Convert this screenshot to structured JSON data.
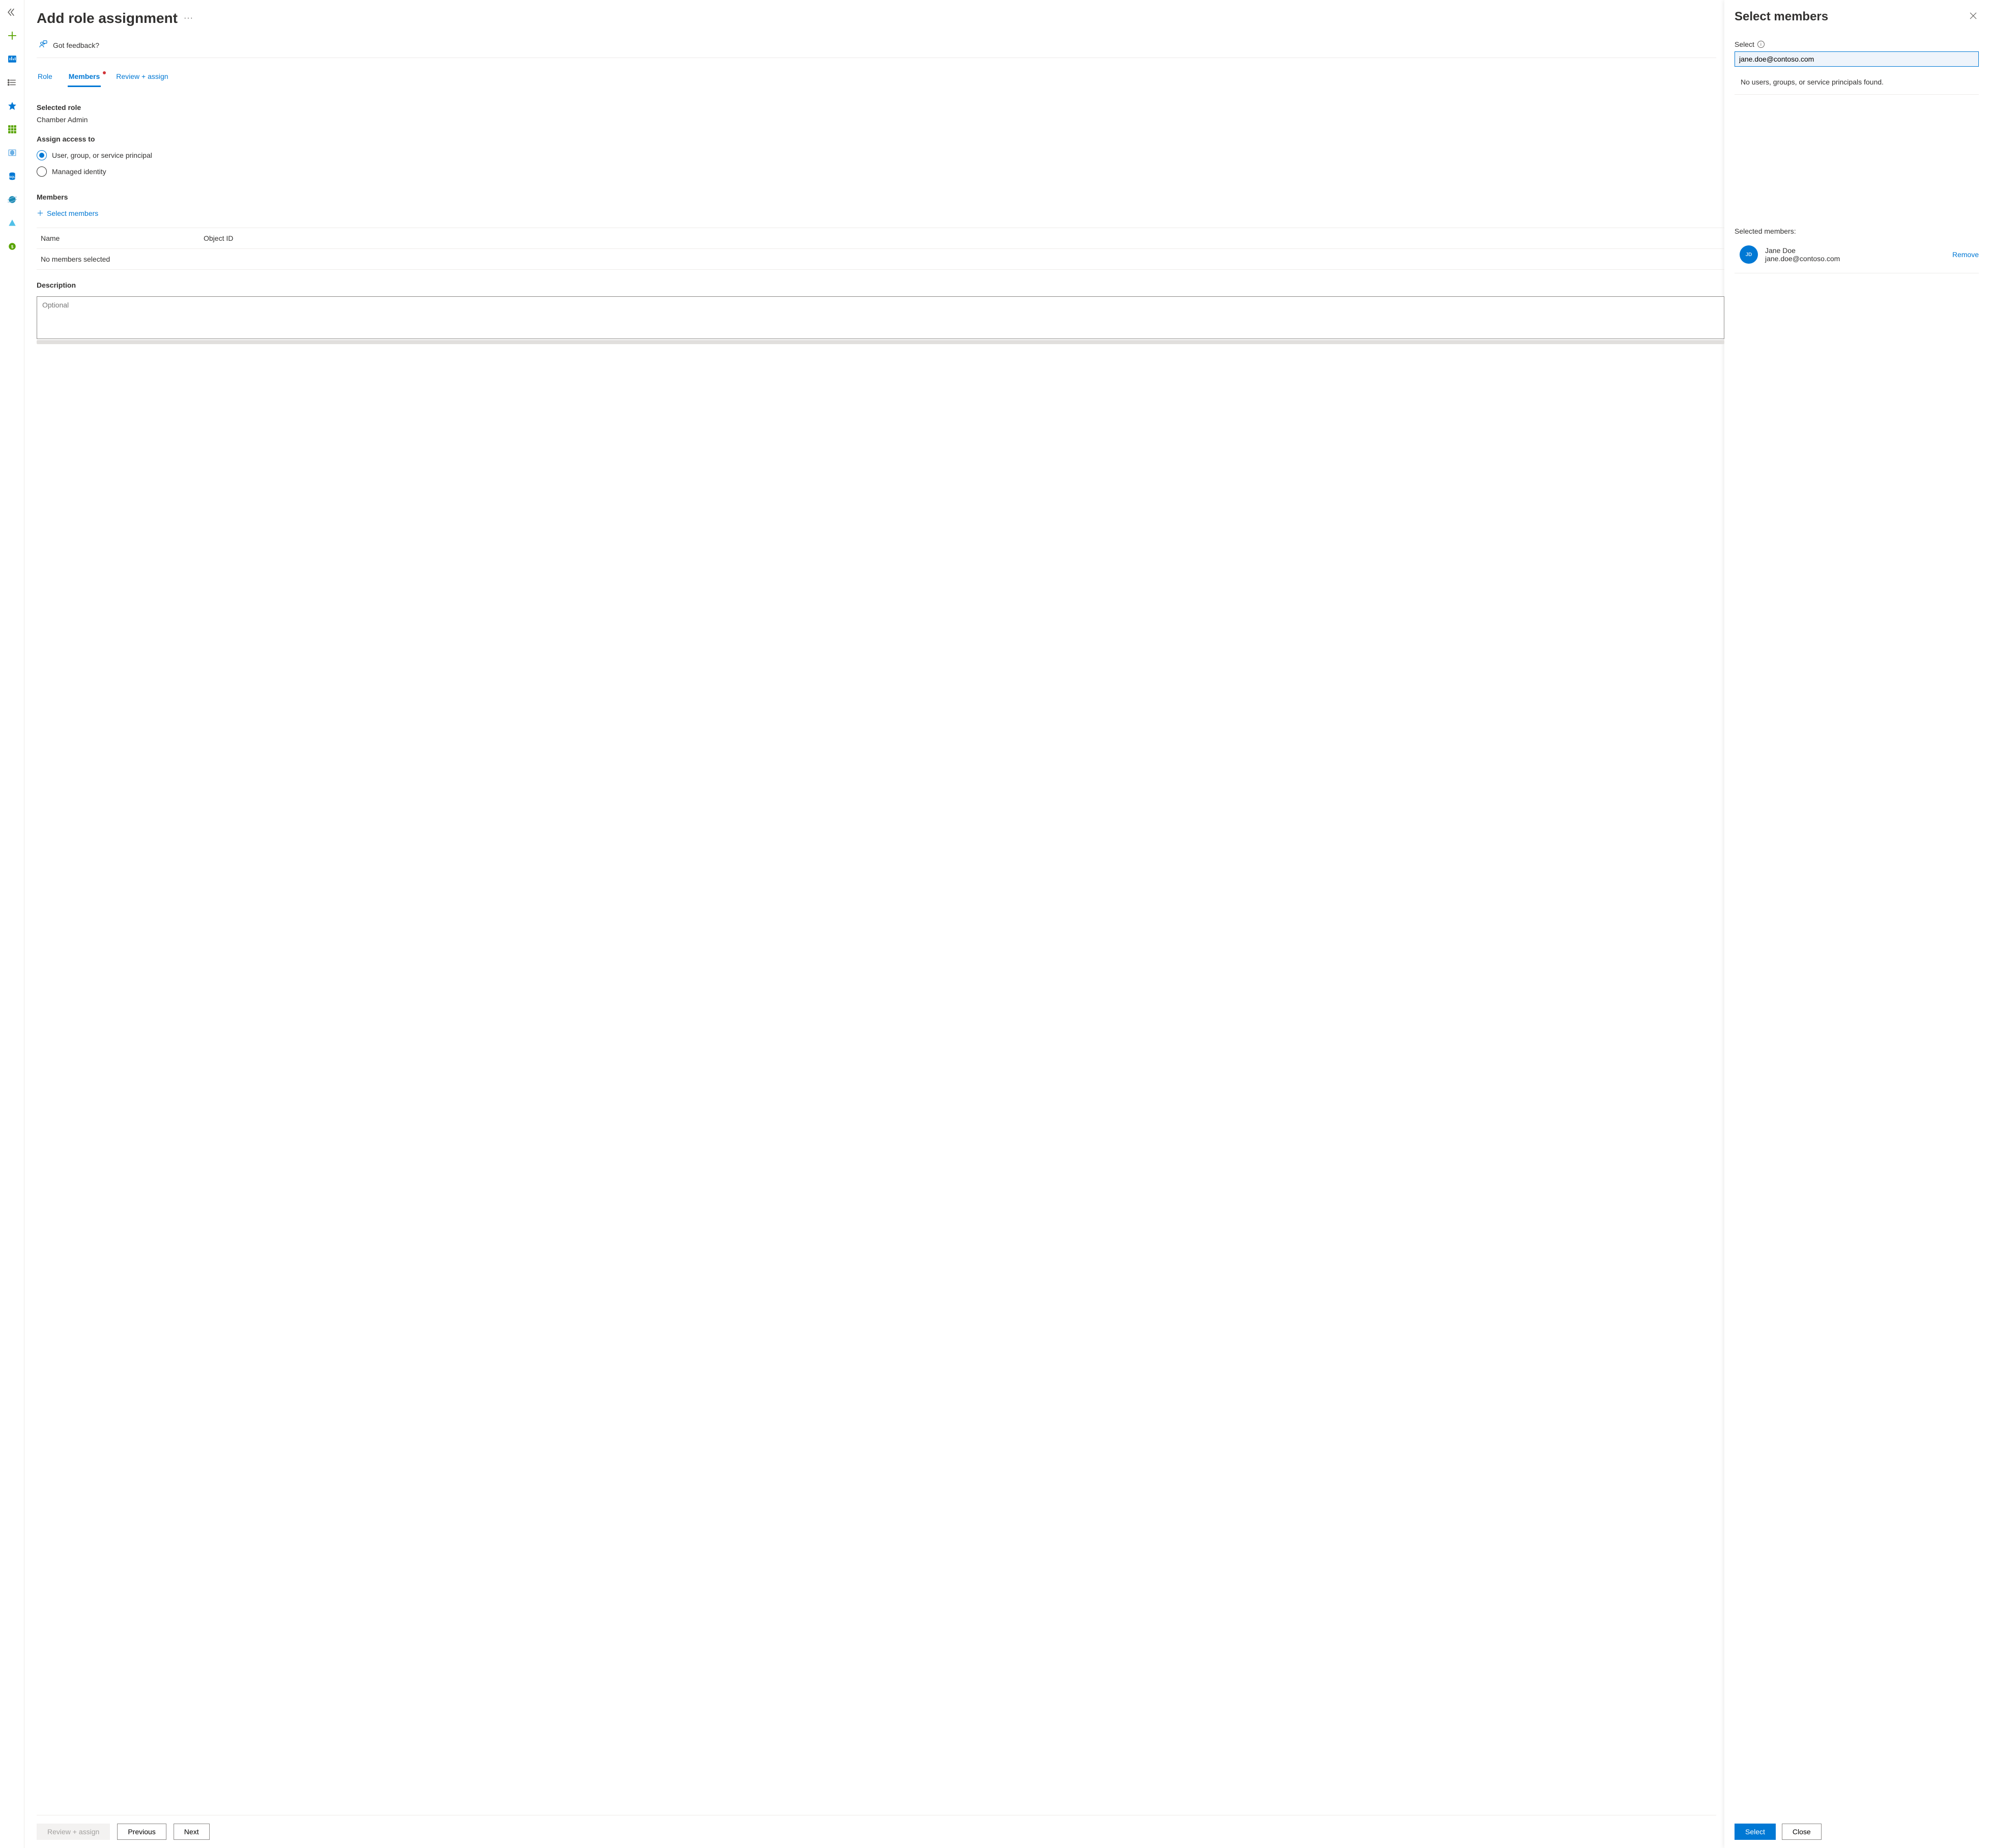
{
  "rail": {
    "icons": [
      "expand",
      "create",
      "dashboard",
      "list",
      "star",
      "grid",
      "cube",
      "sql",
      "globe",
      "pyramid",
      "advisor"
    ]
  },
  "header": {
    "title": "Add role assignment",
    "feedback": "Got feedback?"
  },
  "tabs": {
    "role": "Role",
    "members": "Members",
    "review": "Review + assign"
  },
  "selectedRole": {
    "label": "Selected role",
    "value": "Chamber Admin"
  },
  "assignAccess": {
    "label": "Assign access to",
    "opt1": "User, group, or service principal",
    "opt2": "Managed identity"
  },
  "members": {
    "label": "Members",
    "selectLink": "Select members",
    "colName": "Name",
    "colObjId": "Object ID",
    "empty": "No members selected"
  },
  "description": {
    "label": "Description",
    "placeholder": "Optional"
  },
  "footer": {
    "review": "Review + assign",
    "previous": "Previous",
    "next": "Next"
  },
  "flyout": {
    "title": "Select members",
    "selectLabel": "Select",
    "searchValue": "jane.doe@contoso.com",
    "noResults": "No users, groups, or service principals found.",
    "selectedMembersLabel": "Selected members:",
    "member": {
      "initials": "JD",
      "name": "Jane Doe",
      "email": "jane.doe@contoso.com"
    },
    "remove": "Remove",
    "selectBtn": "Select",
    "closeBtn": "Close"
  }
}
